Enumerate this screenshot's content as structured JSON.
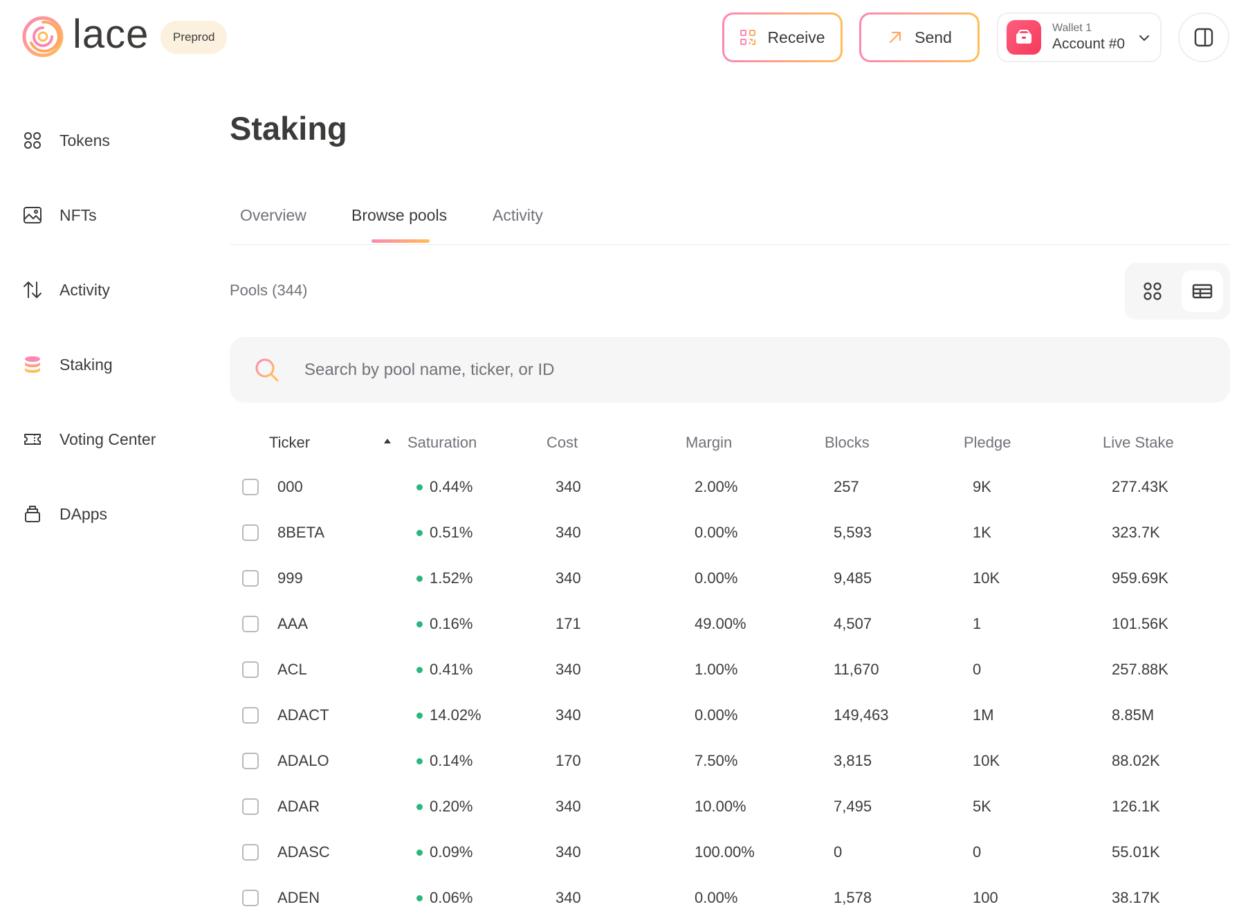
{
  "brand": {
    "name": "lace",
    "network_badge": "Preprod"
  },
  "header": {
    "receive_label": "Receive",
    "send_label": "Send",
    "wallet_name": "Wallet 1",
    "account_name": "Account #0"
  },
  "sidebar": {
    "items": [
      {
        "label": "Tokens",
        "icon": "grid-icon"
      },
      {
        "label": "NFTs",
        "icon": "image-icon"
      },
      {
        "label": "Activity",
        "icon": "arrows-up-down-icon"
      },
      {
        "label": "Staking",
        "icon": "coin-stack-icon"
      },
      {
        "label": "Voting Center",
        "icon": "ticket-icon"
      },
      {
        "label": "DApps",
        "icon": "box-icon"
      }
    ]
  },
  "page": {
    "title": "Staking",
    "tabs": [
      "Overview",
      "Browse pools",
      "Activity"
    ],
    "active_tab": "Browse pools",
    "pools_count": "Pools (344)",
    "search_placeholder": "Search by pool name, ticker, or ID"
  },
  "table": {
    "columns": [
      "Ticker",
      "Saturation",
      "Cost",
      "Margin",
      "Blocks",
      "Pledge",
      "Live Stake"
    ],
    "sorted_by": "Ticker",
    "rows": [
      {
        "ticker": "000",
        "saturation": "0.44%",
        "cost": "340",
        "margin": "2.00%",
        "blocks": "257",
        "pledge": "9K",
        "live_stake": "277.43K"
      },
      {
        "ticker": "8BETA",
        "saturation": "0.51%",
        "cost": "340",
        "margin": "0.00%",
        "blocks": "5,593",
        "pledge": "1K",
        "live_stake": "323.7K"
      },
      {
        "ticker": "999",
        "saturation": "1.52%",
        "cost": "340",
        "margin": "0.00%",
        "blocks": "9,485",
        "pledge": "10K",
        "live_stake": "959.69K"
      },
      {
        "ticker": "AAA",
        "saturation": "0.16%",
        "cost": "171",
        "margin": "49.00%",
        "blocks": "4,507",
        "pledge": "1",
        "live_stake": "101.56K"
      },
      {
        "ticker": "ACL",
        "saturation": "0.41%",
        "cost": "340",
        "margin": "1.00%",
        "blocks": "11,670",
        "pledge": "0",
        "live_stake": "257.88K"
      },
      {
        "ticker": "ADACT",
        "saturation": "14.02%",
        "cost": "340",
        "margin": "0.00%",
        "blocks": "149,463",
        "pledge": "1M",
        "live_stake": "8.85M"
      },
      {
        "ticker": "ADALO",
        "saturation": "0.14%",
        "cost": "170",
        "margin": "7.50%",
        "blocks": "3,815",
        "pledge": "10K",
        "live_stake": "88.02K"
      },
      {
        "ticker": "ADAR",
        "saturation": "0.20%",
        "cost": "340",
        "margin": "10.00%",
        "blocks": "7,495",
        "pledge": "5K",
        "live_stake": "126.1K"
      },
      {
        "ticker": "ADASC",
        "saturation": "0.09%",
        "cost": "340",
        "margin": "100.00%",
        "blocks": "0",
        "pledge": "0",
        "live_stake": "55.01K"
      },
      {
        "ticker": "ADEN",
        "saturation": "0.06%",
        "cost": "340",
        "margin": "0.00%",
        "blocks": "1,578",
        "pledge": "100",
        "live_stake": "38.17K"
      }
    ]
  },
  "colors": {
    "text": "#3d3b39",
    "muted": "#6f7278",
    "accent_pink": "#fd87b4",
    "accent_orange": "#ffbd58",
    "saturation_dot": "#2cb67d"
  }
}
